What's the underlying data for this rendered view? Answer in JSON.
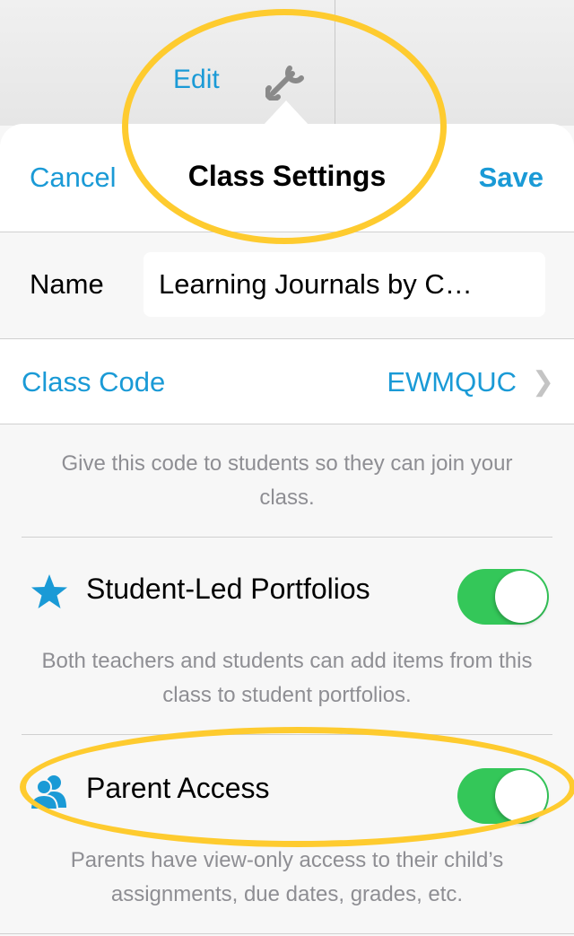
{
  "background": {
    "edit_label": "Edit",
    "wrench_icon": "wrench-icon"
  },
  "navbar": {
    "cancel_label": "Cancel",
    "title": "Class Settings",
    "save_label": "Save"
  },
  "name_field": {
    "label": "Name",
    "value": "Learning Journals by C…"
  },
  "class_code": {
    "label": "Class Code",
    "value": "EWMQUC",
    "chevron_icon": "chevron-right-icon",
    "note": "Give this code to students so they can join your class."
  },
  "student_led_portfolios": {
    "icon": "star-icon",
    "label": "Student-Led Portfolios",
    "enabled": true,
    "note": "Both teachers and students can add items from this class to student portfolios."
  },
  "parent_access": {
    "icon": "parents-icon",
    "label": "Parent Access",
    "enabled": true,
    "note": "Parents have view-only access to their child’s assignments, due dates, grades, etc."
  },
  "colors": {
    "accent": "#1a9ad6",
    "toggle_on": "#34c759",
    "annotation_ring": "#fecb2f"
  }
}
